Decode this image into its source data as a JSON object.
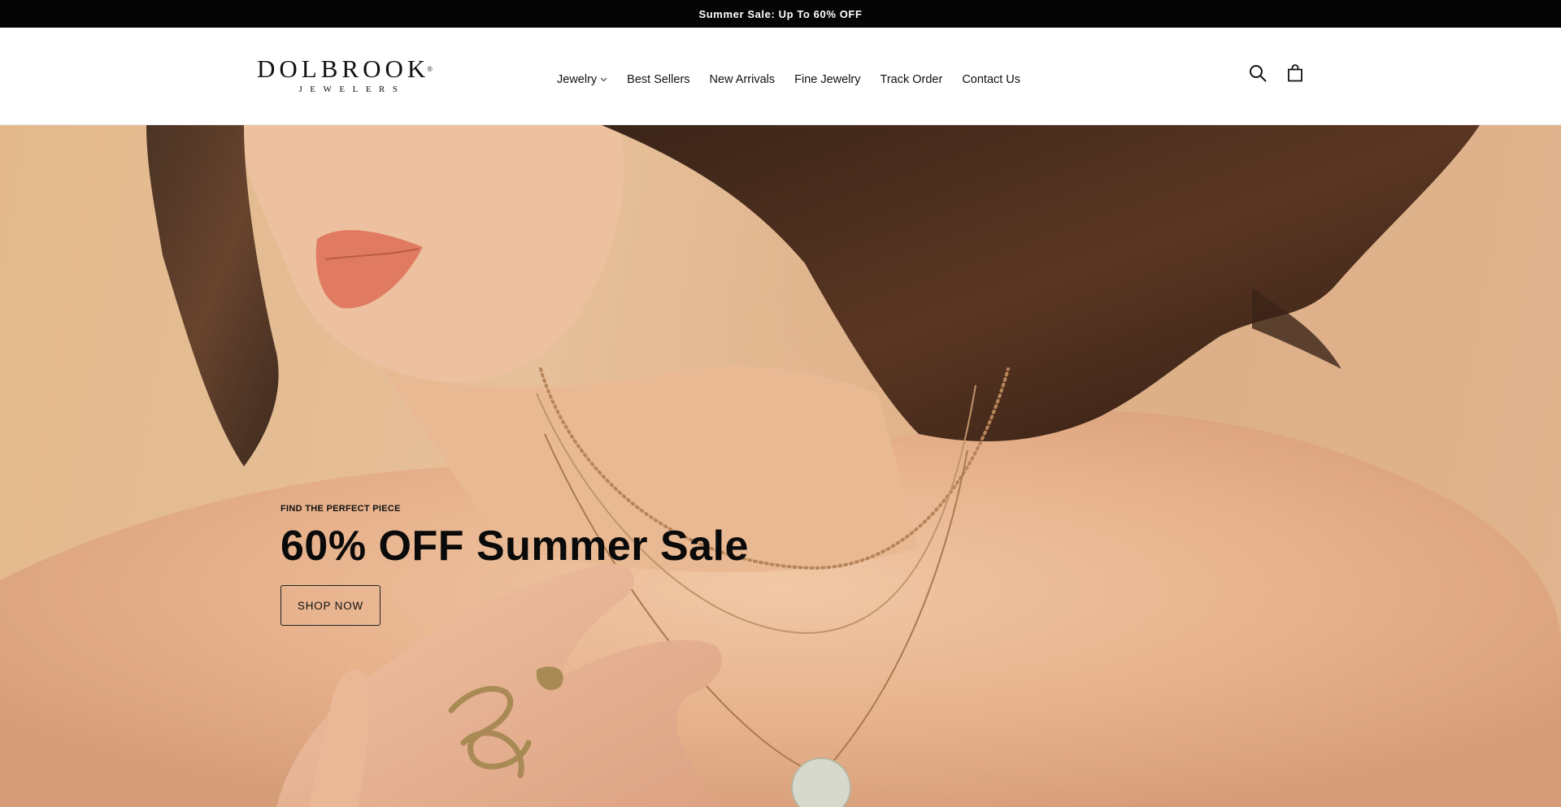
{
  "announcement": {
    "text": "Summer Sale: Up To 60% OFF"
  },
  "header": {
    "logo": {
      "name": "DOLBROOK",
      "mark": "®",
      "sub": "JEWELERS"
    },
    "nav": [
      {
        "label": "Jewelry",
        "has_dropdown": true
      },
      {
        "label": "Best Sellers"
      },
      {
        "label": "New Arrivals"
      },
      {
        "label": "Fine Jewelry"
      },
      {
        "label": "Track Order"
      },
      {
        "label": "Contact Us"
      }
    ],
    "icons": [
      "search-icon",
      "shopping-bag-icon"
    ]
  },
  "hero": {
    "eyebrow": "FIND THE PERFECT PIECE",
    "headline": "60% OFF Summer Sale",
    "cta_label": "SHOP NOW"
  },
  "colors": {
    "announcement_bg": "#050505",
    "announcement_text": "#ffffff",
    "header_bg": "#ffffff",
    "hero_bg": "#e3b98c",
    "text": "#111111"
  }
}
